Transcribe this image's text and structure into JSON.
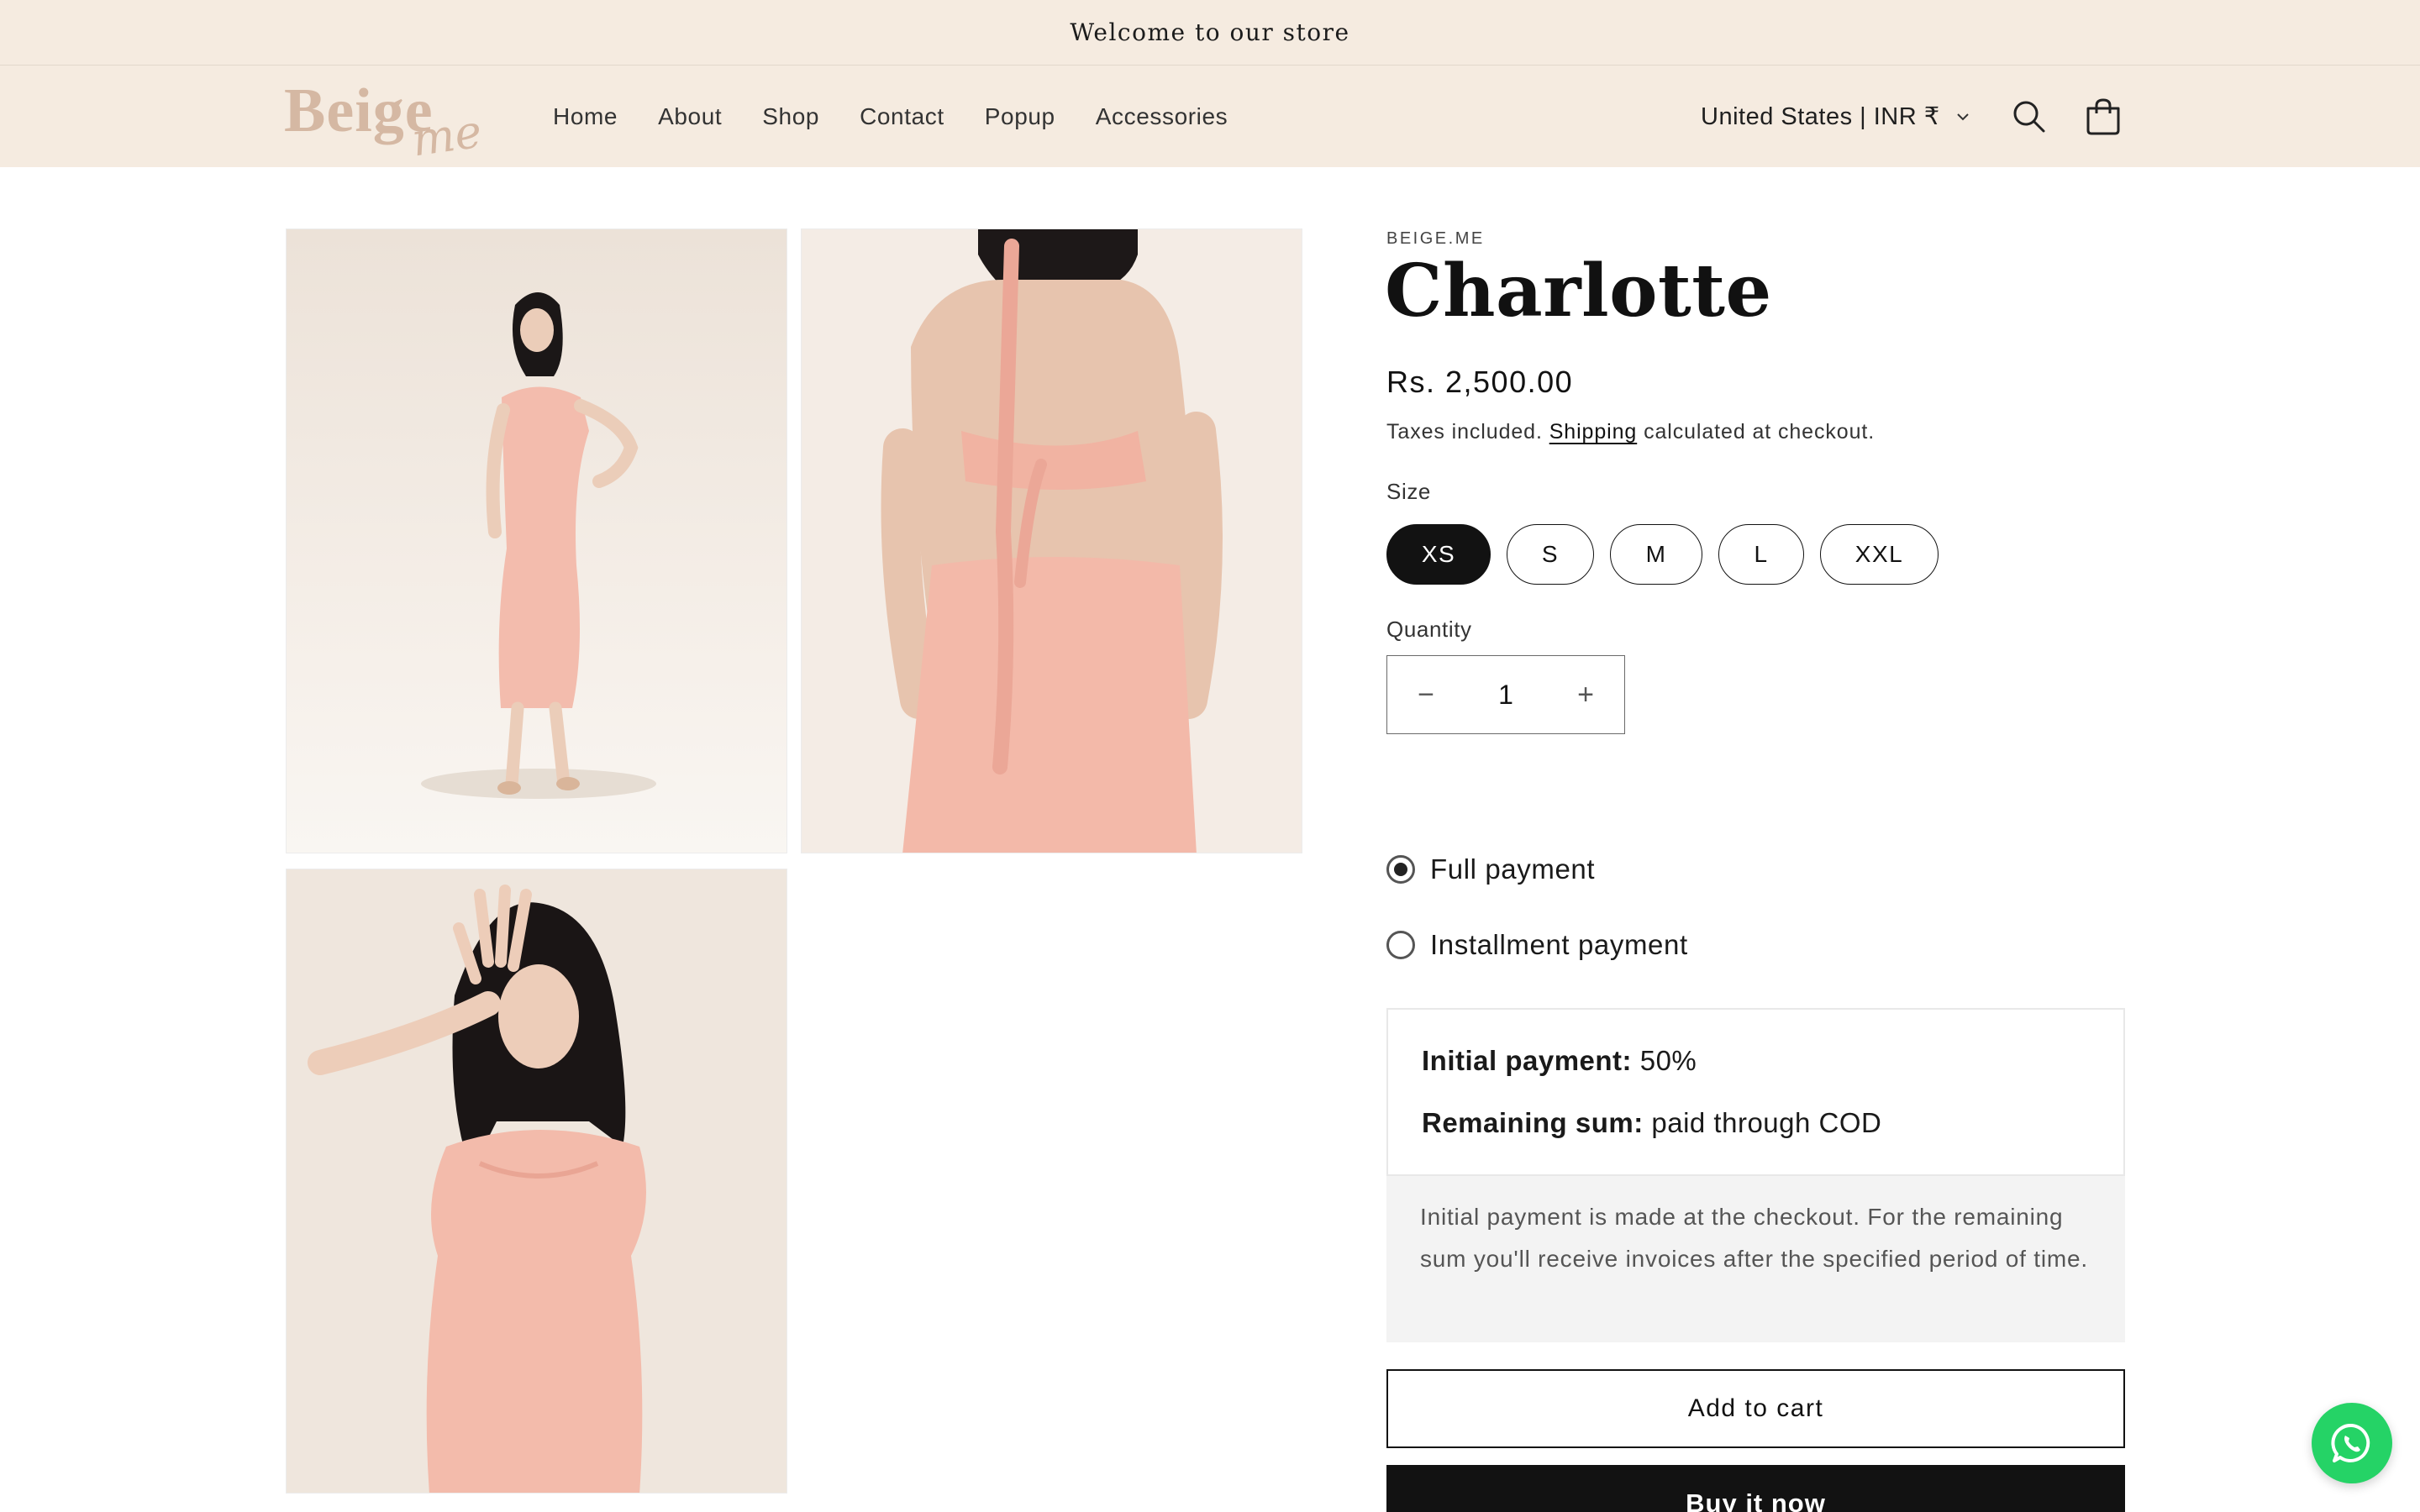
{
  "announcement": {
    "text": "Welcome to our store"
  },
  "header": {
    "logo": {
      "line1": "Beige",
      "line2": "me"
    },
    "nav": [
      {
        "label": "Home"
      },
      {
        "label": "About"
      },
      {
        "label": "Shop"
      },
      {
        "label": "Contact"
      },
      {
        "label": "Popup"
      },
      {
        "label": "Accessories"
      }
    ],
    "locale": "United States | INR ₹",
    "icons": {
      "search": "search-icon",
      "cart": "cart-icon",
      "locale_dropdown": "chevron-down-icon"
    }
  },
  "gallery": {
    "images": [
      {
        "name": "product-photo-front",
        "description_icon": "photo"
      },
      {
        "name": "product-photo-back",
        "description_icon": "photo"
      },
      {
        "name": "product-photo-detail",
        "description_icon": "photo"
      }
    ]
  },
  "product": {
    "vendor": "BEIGE.ME",
    "title": "Charlotte",
    "price": "Rs. 2,500.00",
    "taxes_prefix": "Taxes included.",
    "shipping_link": "Shipping",
    "taxes_suffix": "calculated at checkout.",
    "size_label": "Size",
    "sizes": [
      {
        "label": "XS",
        "selected": true
      },
      {
        "label": "S",
        "selected": false
      },
      {
        "label": "M",
        "selected": false
      },
      {
        "label": "L",
        "selected": false
      },
      {
        "label": "XXL",
        "selected": false
      }
    ],
    "quantity_label": "Quantity",
    "quantity": "1",
    "quantity_minus": "−",
    "quantity_plus": "+"
  },
  "payment": {
    "options": [
      {
        "label": "Full payment",
        "checked": true
      },
      {
        "label": "Installment payment",
        "checked": false
      }
    ],
    "initial_label": "Initial payment:",
    "initial_value": "50%",
    "remaining_label": "Remaining sum:",
    "remaining_value": "paid through COD",
    "note": "Initial payment is made at the checkout. For the remaining sum you'll receive invoices after the specified period of time."
  },
  "actions": {
    "add_to_cart": "Add to cart",
    "buy_now": "Buy it now"
  },
  "colors": {
    "header_bg": "#f5ebe0",
    "logo": "#d5b8a3",
    "primary": "#121212",
    "whatsapp": "#25d366",
    "dress": "#f2b8a8"
  }
}
